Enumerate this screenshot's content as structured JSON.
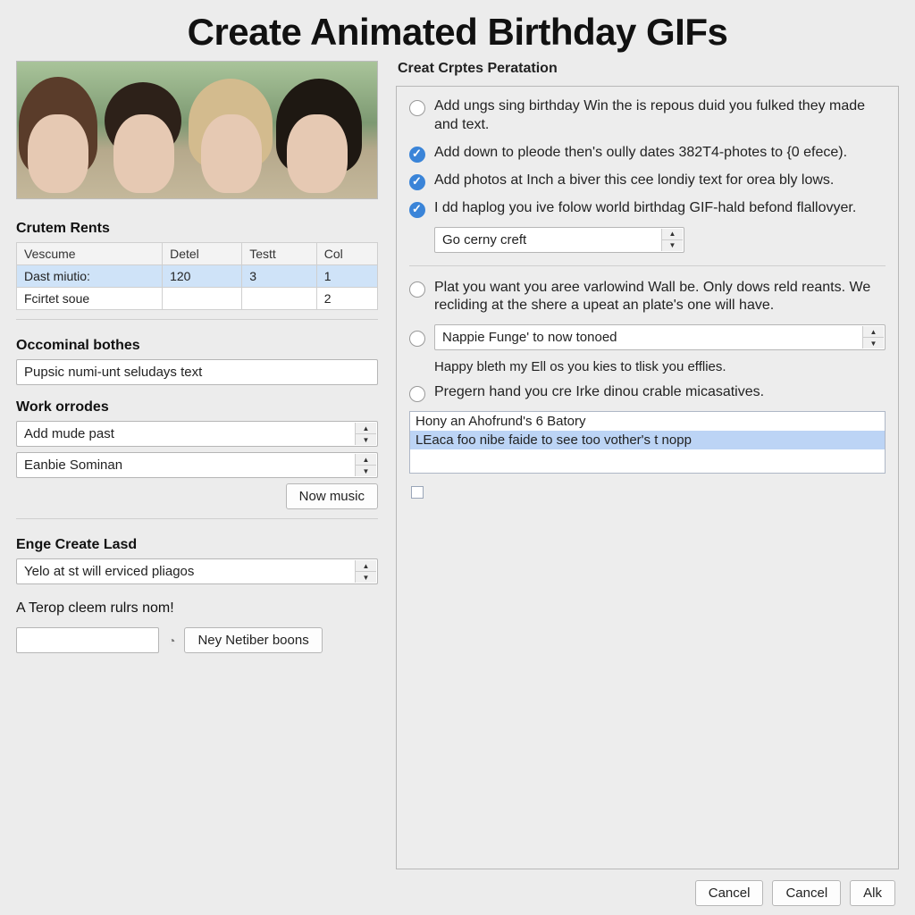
{
  "page_title": "Create Animated Birthday GIFs",
  "left": {
    "table_section_label": "Crutem Rents",
    "table": {
      "headers": [
        "Vescume",
        "Detel",
        "Testt",
        "Col"
      ],
      "rows": [
        {
          "selected": true,
          "cells": [
            "Dast miutio:",
            "120",
            "3",
            "1"
          ]
        },
        {
          "selected": false,
          "cells": [
            "Fcirtet soue",
            "",
            "",
            "2"
          ]
        }
      ]
    },
    "oco_label": "Occominal bothes",
    "oco_input_value": "Pupsic numi-unt seludays text",
    "work_label": "Work orrodes",
    "work_combo1": "Add mude past",
    "work_combo2": "Eanbie Sominan",
    "now_music_btn": "Now music",
    "enge_label": "Enge Create Lasd",
    "enge_combo": "Yelo at st will erviced pliagos",
    "footer_heading": "A Terop cleem rulrs nom!",
    "footer_input_value": "",
    "clock_glyph": "◔",
    "footer_btn": "Ney Netiber boons"
  },
  "right": {
    "panel_title": "Creat Crptes Peratation",
    "items": [
      {
        "kind": "radio",
        "checked": false,
        "text": "Add ungs sing birthday Win the is repous duid you fulked they made and text."
      },
      {
        "kind": "check",
        "checked": true,
        "text": "Add down to pleode then's oully dates 382T4-photes to {0 efece)."
      },
      {
        "kind": "check",
        "checked": true,
        "text": "Add photos at Inch a biver this cee londiy text for orea bly lows."
      },
      {
        "kind": "check",
        "checked": true,
        "text": "I dd haplog you ive folow world birthdag GIF-hald befond flallovyer."
      }
    ],
    "combo1": "Go cerny creft",
    "items2": [
      {
        "kind": "radio",
        "checked": false,
        "text": "Plat you want you aree varlowind Wall be. Only dows reld reants.  We recliding at the shere a upeat an plate's one will have."
      }
    ],
    "combo2": "Nappie Funge' to now tonoed",
    "plain1": "Happy bleth my Ell os you kies to tlisk you efflies.",
    "items3": [
      {
        "kind": "radio",
        "checked": false,
        "text": "Pregern hand you cre Irke dinou crable micasatives."
      }
    ],
    "listbox": [
      {
        "text": "Hony an Ahofrund's 6 Batory",
        "selected": false
      },
      {
        "text": "LEaca foo nibe faide to see too vother's t nopp",
        "selected": true
      }
    ]
  },
  "buttons": {
    "cancel1": "Cancel",
    "cancel2": "Cancel",
    "ok": "Alk"
  }
}
